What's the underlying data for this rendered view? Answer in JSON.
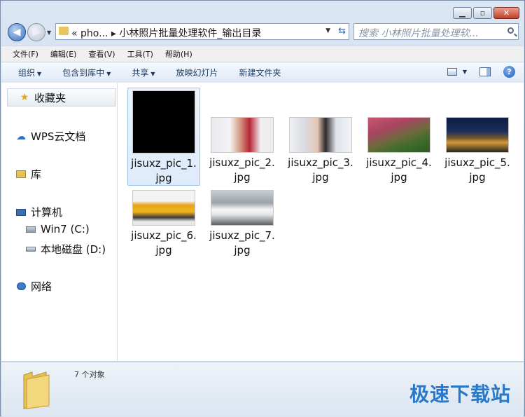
{
  "window": {
    "min_glyph": "▁",
    "max_glyph": "▫",
    "close_glyph": "✕"
  },
  "address": {
    "text": "« pho... ▸ 小林照片批量处理软件_输出目录"
  },
  "search": {
    "placeholder": "搜索 小林照片批量处理软..."
  },
  "menu": [
    "文件(F)",
    "编辑(E)",
    "查看(V)",
    "工具(T)",
    "帮助(H)"
  ],
  "toolbar": {
    "organize": "组织",
    "include": "包含到库中",
    "share": "共享",
    "slideshow": "放映幻灯片",
    "new_folder": "新建文件夹",
    "help_glyph": "?"
  },
  "sidebar": {
    "favorites": "收藏夹",
    "wps": "WPS云文档",
    "library": "库",
    "computer": "计算机",
    "drive_c": "Win7 (C:)",
    "drive_d": "本地磁盘 (D:)",
    "network": "网络"
  },
  "files": [
    {
      "line1": "jisuxz_pic_1.",
      "line2": "jpg"
    },
    {
      "line1": "jisuxz_pic_2.",
      "line2": "jpg"
    },
    {
      "line1": "jisuxz_pic_3.",
      "line2": "jpg"
    },
    {
      "line1": "jisuxz_pic_4.",
      "line2": "jpg"
    },
    {
      "line1": "jisuxz_pic_5.",
      "line2": "jpg"
    },
    {
      "line1": "jisuxz_pic_6.",
      "line2": "jpg"
    },
    {
      "line1": "jisuxz_pic_7.",
      "line2": "jpg"
    }
  ],
  "status": {
    "count": "7 个对象"
  },
  "watermark": "极速下载站",
  "colors": {
    "accent": "#2a78c9",
    "selection": "#cce1f7"
  }
}
